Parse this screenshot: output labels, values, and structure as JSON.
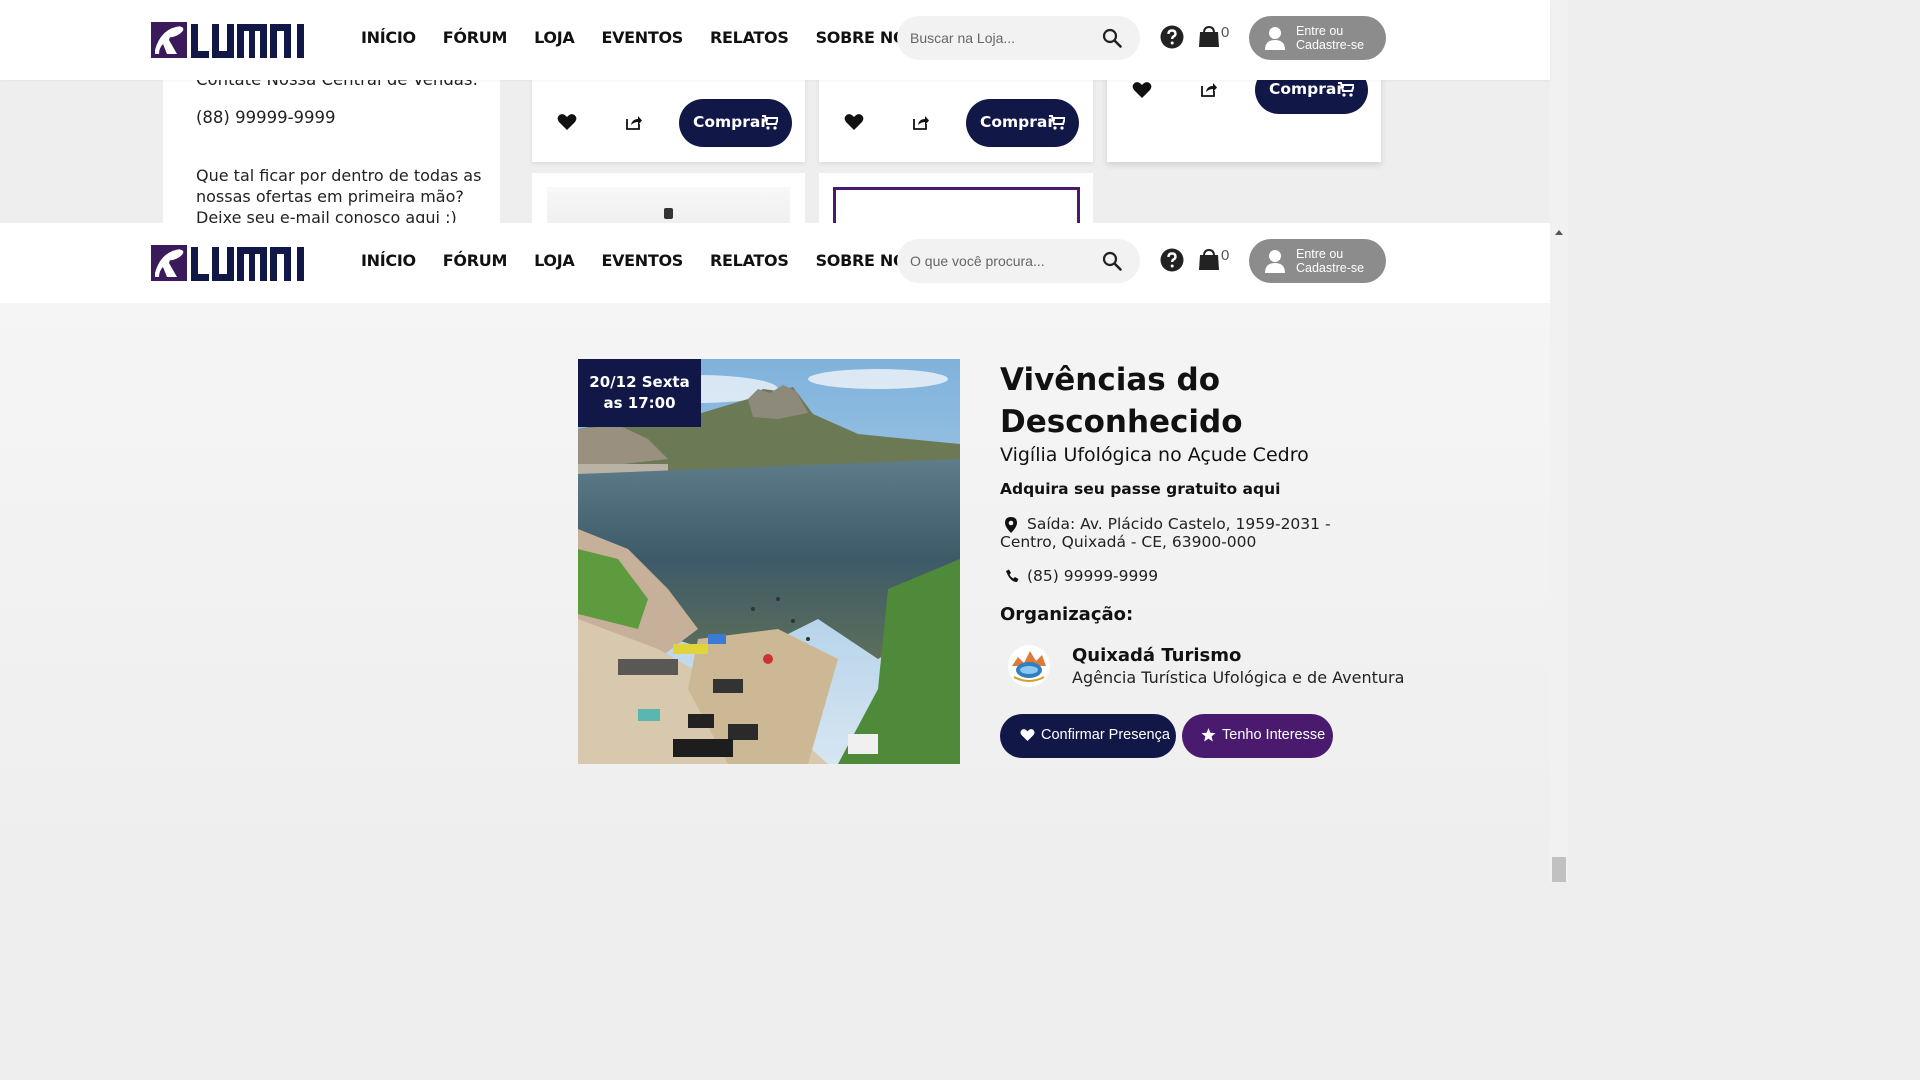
{
  "header_top": {
    "nav": [
      "INÍCIO",
      "FÓRUM",
      "LOJA",
      "EVENTOS",
      "RELATOS",
      "SOBRE NÓS"
    ],
    "search_placeholder": "Buscar na Loja...",
    "cart_count": "0",
    "login_line1": "Entre ou",
    "login_line2": "Cadastre-se"
  },
  "header_event": {
    "nav": [
      "INÍCIO",
      "FÓRUM",
      "LOJA",
      "EVENTOS",
      "RELATOS",
      "SOBRE NÓS"
    ],
    "search_placeholder": "O que você procura...",
    "cart_count": "0",
    "login_line1": "Entre ou",
    "login_line2": "Cadastre-se"
  },
  "store": {
    "contact_title": "Contate Nossa Central de Vendas:",
    "contact_phone": "(88) 99999-9999",
    "newsletter_text": "Que tal ficar por dentro de todas as nossas ofertas em primeira mão? Deixe seu e-mail conosco aqui :)",
    "buy_label": "Comprar"
  },
  "event": {
    "date_line1": "20/12 Sexta",
    "date_line2": "as 17:00",
    "title": "Vivências do Desconhecido",
    "subtitle": "Vigília Ufológica no Açude Cedro",
    "pass_text": "Adquira seu passe gratuito aqui",
    "address": "Saída: Av. Plácido Castelo, 1959-2031 - Centro, Quixadá - CE, 63900-000",
    "phone": "(85) 99999-9999",
    "organization_heading": "Organização:",
    "org_name": "Quixadá Turismo",
    "org_description": "Agência Turística Ufológica e de Aventura",
    "confirm_label": "Confirmar Presença",
    "interest_label": "Tenho Interesse"
  },
  "colors": {
    "navy": "#111747",
    "purple": "#4a1a6e",
    "login_gray": "#8c8c8c",
    "logo_purple": "#3b1a5c"
  },
  "icons": [
    "search-icon",
    "help-icon",
    "cart-icon",
    "user-icon",
    "heart-icon",
    "share-icon",
    "map-pin-icon",
    "phone-icon",
    "star-icon"
  ]
}
